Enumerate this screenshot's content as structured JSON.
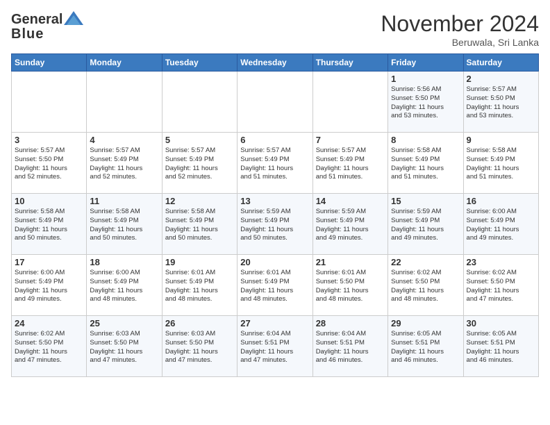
{
  "header": {
    "logo_general": "General",
    "logo_blue": "Blue",
    "month": "November 2024",
    "location": "Beruwala, Sri Lanka"
  },
  "weekdays": [
    "Sunday",
    "Monday",
    "Tuesday",
    "Wednesday",
    "Thursday",
    "Friday",
    "Saturday"
  ],
  "weeks": [
    [
      {
        "day": "",
        "info": ""
      },
      {
        "day": "",
        "info": ""
      },
      {
        "day": "",
        "info": ""
      },
      {
        "day": "",
        "info": ""
      },
      {
        "day": "",
        "info": ""
      },
      {
        "day": "1",
        "info": "Sunrise: 5:56 AM\nSunset: 5:50 PM\nDaylight: 11 hours\nand 53 minutes."
      },
      {
        "day": "2",
        "info": "Sunrise: 5:57 AM\nSunset: 5:50 PM\nDaylight: 11 hours\nand 53 minutes."
      }
    ],
    [
      {
        "day": "3",
        "info": "Sunrise: 5:57 AM\nSunset: 5:50 PM\nDaylight: 11 hours\nand 52 minutes."
      },
      {
        "day": "4",
        "info": "Sunrise: 5:57 AM\nSunset: 5:49 PM\nDaylight: 11 hours\nand 52 minutes."
      },
      {
        "day": "5",
        "info": "Sunrise: 5:57 AM\nSunset: 5:49 PM\nDaylight: 11 hours\nand 52 minutes."
      },
      {
        "day": "6",
        "info": "Sunrise: 5:57 AM\nSunset: 5:49 PM\nDaylight: 11 hours\nand 51 minutes."
      },
      {
        "day": "7",
        "info": "Sunrise: 5:57 AM\nSunset: 5:49 PM\nDaylight: 11 hours\nand 51 minutes."
      },
      {
        "day": "8",
        "info": "Sunrise: 5:58 AM\nSunset: 5:49 PM\nDaylight: 11 hours\nand 51 minutes."
      },
      {
        "day": "9",
        "info": "Sunrise: 5:58 AM\nSunset: 5:49 PM\nDaylight: 11 hours\nand 51 minutes."
      }
    ],
    [
      {
        "day": "10",
        "info": "Sunrise: 5:58 AM\nSunset: 5:49 PM\nDaylight: 11 hours\nand 50 minutes."
      },
      {
        "day": "11",
        "info": "Sunrise: 5:58 AM\nSunset: 5:49 PM\nDaylight: 11 hours\nand 50 minutes."
      },
      {
        "day": "12",
        "info": "Sunrise: 5:58 AM\nSunset: 5:49 PM\nDaylight: 11 hours\nand 50 minutes."
      },
      {
        "day": "13",
        "info": "Sunrise: 5:59 AM\nSunset: 5:49 PM\nDaylight: 11 hours\nand 50 minutes."
      },
      {
        "day": "14",
        "info": "Sunrise: 5:59 AM\nSunset: 5:49 PM\nDaylight: 11 hours\nand 49 minutes."
      },
      {
        "day": "15",
        "info": "Sunrise: 5:59 AM\nSunset: 5:49 PM\nDaylight: 11 hours\nand 49 minutes."
      },
      {
        "day": "16",
        "info": "Sunrise: 6:00 AM\nSunset: 5:49 PM\nDaylight: 11 hours\nand 49 minutes."
      }
    ],
    [
      {
        "day": "17",
        "info": "Sunrise: 6:00 AM\nSunset: 5:49 PM\nDaylight: 11 hours\nand 49 minutes."
      },
      {
        "day": "18",
        "info": "Sunrise: 6:00 AM\nSunset: 5:49 PM\nDaylight: 11 hours\nand 48 minutes."
      },
      {
        "day": "19",
        "info": "Sunrise: 6:01 AM\nSunset: 5:49 PM\nDaylight: 11 hours\nand 48 minutes."
      },
      {
        "day": "20",
        "info": "Sunrise: 6:01 AM\nSunset: 5:49 PM\nDaylight: 11 hours\nand 48 minutes."
      },
      {
        "day": "21",
        "info": "Sunrise: 6:01 AM\nSunset: 5:50 PM\nDaylight: 11 hours\nand 48 minutes."
      },
      {
        "day": "22",
        "info": "Sunrise: 6:02 AM\nSunset: 5:50 PM\nDaylight: 11 hours\nand 48 minutes."
      },
      {
        "day": "23",
        "info": "Sunrise: 6:02 AM\nSunset: 5:50 PM\nDaylight: 11 hours\nand 47 minutes."
      }
    ],
    [
      {
        "day": "24",
        "info": "Sunrise: 6:02 AM\nSunset: 5:50 PM\nDaylight: 11 hours\nand 47 minutes."
      },
      {
        "day": "25",
        "info": "Sunrise: 6:03 AM\nSunset: 5:50 PM\nDaylight: 11 hours\nand 47 minutes."
      },
      {
        "day": "26",
        "info": "Sunrise: 6:03 AM\nSunset: 5:50 PM\nDaylight: 11 hours\nand 47 minutes."
      },
      {
        "day": "27",
        "info": "Sunrise: 6:04 AM\nSunset: 5:51 PM\nDaylight: 11 hours\nand 47 minutes."
      },
      {
        "day": "28",
        "info": "Sunrise: 6:04 AM\nSunset: 5:51 PM\nDaylight: 11 hours\nand 46 minutes."
      },
      {
        "day": "29",
        "info": "Sunrise: 6:05 AM\nSunset: 5:51 PM\nDaylight: 11 hours\nand 46 minutes."
      },
      {
        "day": "30",
        "info": "Sunrise: 6:05 AM\nSunset: 5:51 PM\nDaylight: 11 hours\nand 46 minutes."
      }
    ]
  ]
}
